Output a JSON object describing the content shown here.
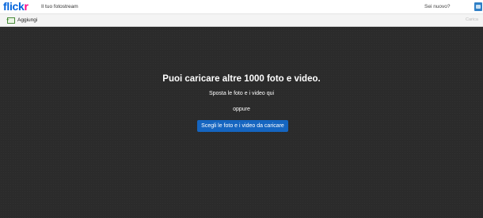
{
  "header": {
    "logo_flick": "flick",
    "logo_r": "r",
    "nav_fotostream": "Il tuo fotostream",
    "nav_new": "Sei nuovo?"
  },
  "toolbar": {
    "add_label": "Aggiungi",
    "upload_label": "Carica"
  },
  "dropzone": {
    "headline": "Puoi caricare altre 1000 foto e video.",
    "drag_text": "Sposta le foto e i video qui",
    "or_text": "oppure",
    "choose_button": "Scegli le foto e i video da caricare"
  },
  "colors": {
    "brand_blue": "#0063dc",
    "brand_pink": "#ff0084",
    "button_blue": "#1565c0",
    "dropzone_bg": "#2b2b2b"
  }
}
